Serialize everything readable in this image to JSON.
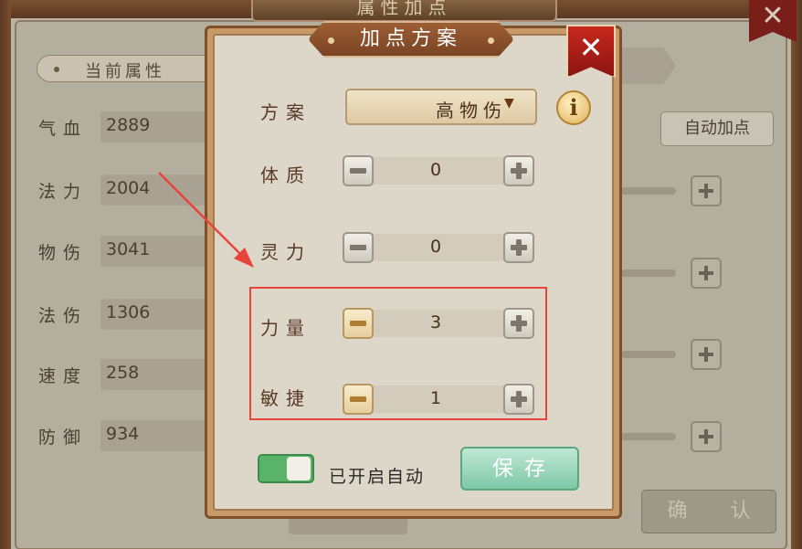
{
  "background": {
    "title": "属性加点",
    "tab_label": "当前属性",
    "stats": [
      {
        "label": "气血",
        "value": "2889"
      },
      {
        "label": "法力",
        "value": "2004"
      },
      {
        "label": "物伤",
        "value": "3041"
      },
      {
        "label": "法伤",
        "value": "1306"
      },
      {
        "label": "速度",
        "value": "258"
      },
      {
        "label": "防御",
        "value": "934"
      }
    ],
    "auto_allocate_label": "自动加点",
    "confirm_label": "确 认"
  },
  "dialog": {
    "title": "加点方案",
    "plan": {
      "label": "方案",
      "selected": "高物伤"
    },
    "attributes": [
      {
        "label": "体质",
        "value": "0"
      },
      {
        "label": "灵力",
        "value": "0"
      },
      {
        "label": "力量",
        "value": "3"
      },
      {
        "label": "敏捷",
        "value": "1"
      }
    ],
    "auto_toggle": {
      "on": true,
      "label": "已开启自动"
    },
    "save_label": "保存"
  },
  "colors": {
    "annotation_red": "#e8443c",
    "toggle_green": "#59b46a",
    "close_red": "#c8281e",
    "save_green": "#7ec8a6"
  },
  "icons": [
    "close-icon",
    "dropdown-arrow-icon",
    "info-icon",
    "minus-icon",
    "plus-icon",
    "arrow-annotation"
  ]
}
